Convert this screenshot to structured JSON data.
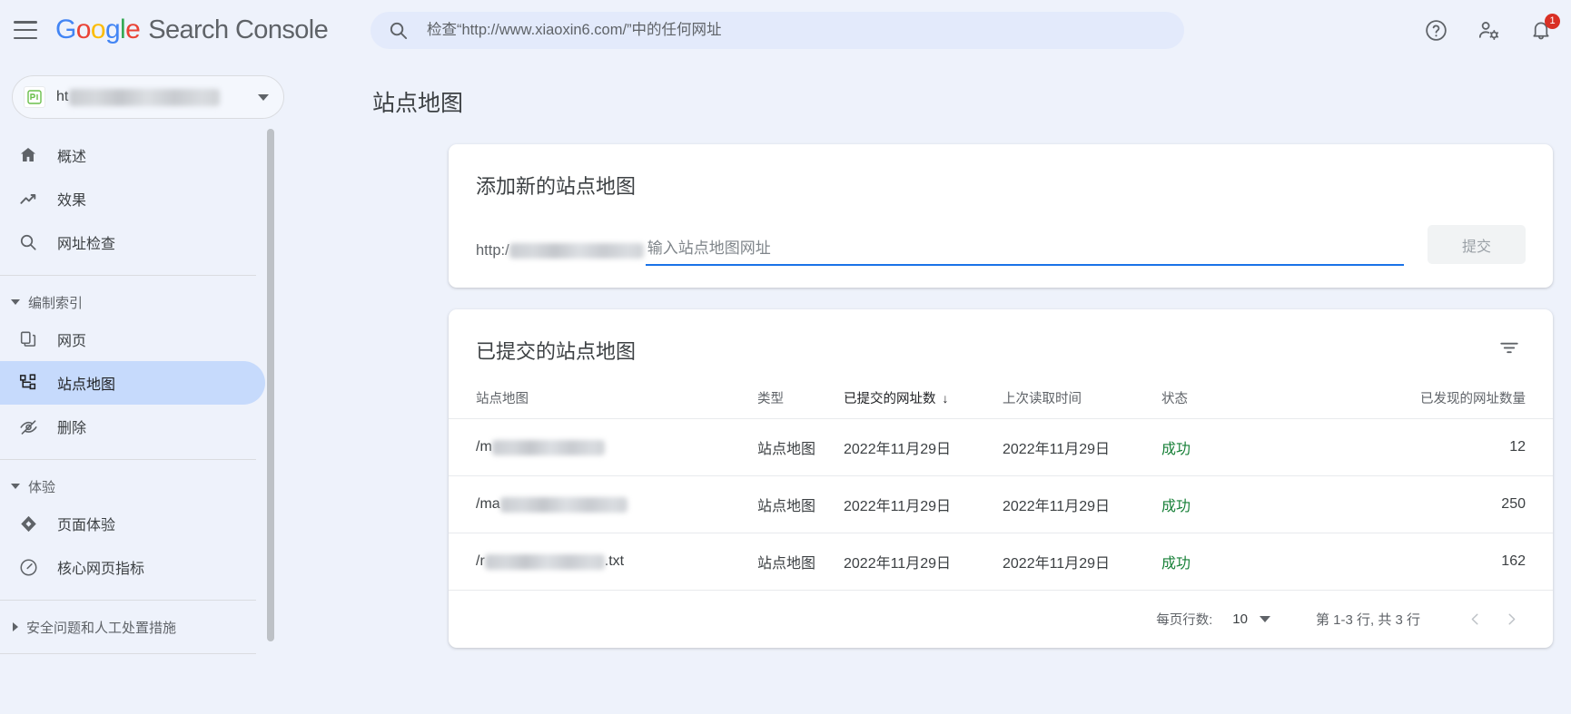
{
  "header": {
    "menu_icon": "hamburger-icon",
    "brand_google": [
      "G",
      "o",
      "o",
      "g",
      "l",
      "e"
    ],
    "brand_product": "Search Console",
    "search": {
      "icon": "search-icon",
      "value": "",
      "placeholder": "检查“http://www.xiaoxin6.com/”中的任何网址"
    },
    "icons": {
      "help": "help-icon",
      "account_settings": "account-settings-icon",
      "notifications": "bell-icon",
      "notification_count": "1"
    }
  },
  "sidebar": {
    "property": {
      "favicon": "site-favicon",
      "prefix": "ht",
      "redacted": true
    },
    "items": [
      {
        "label": "概述",
        "icon": "home-icon",
        "active": false
      },
      {
        "label": "效果",
        "icon": "trending-up-icon",
        "active": false
      },
      {
        "label": "网址检查",
        "icon": "search-icon",
        "active": false
      }
    ],
    "groups": [
      {
        "label": "编制索引",
        "expanded": true,
        "items": [
          {
            "label": "网页",
            "icon": "pages-icon",
            "active": false
          },
          {
            "label": "站点地图",
            "icon": "sitemap-icon",
            "active": true
          },
          {
            "label": "删除",
            "icon": "eye-off-icon",
            "active": false
          }
        ]
      },
      {
        "label": "体验",
        "expanded": true,
        "items": [
          {
            "label": "页面体验",
            "icon": "page-experience-icon",
            "active": false
          },
          {
            "label": "核心网页指标",
            "icon": "speedometer-icon",
            "active": false
          }
        ]
      },
      {
        "label": "安全问题和人工处置措施",
        "expanded": false,
        "items": []
      }
    ]
  },
  "main": {
    "page_title": "站点地图",
    "add_card": {
      "title": "添加新的站点地图",
      "url_prefix": "http:/",
      "input_value": "",
      "input_placeholder": "输入站点地图网址",
      "submit_label": "提交",
      "submit_disabled": true
    },
    "table_card": {
      "title": "已提交的站点地图",
      "filter_icon": "filter-icon",
      "columns": [
        {
          "label": "站点地图",
          "sorted": false,
          "align": "left"
        },
        {
          "label": "类型",
          "sorted": false,
          "align": "left"
        },
        {
          "label": "已提交的网址数",
          "sorted": true,
          "sort_dir": "↓",
          "align": "left"
        },
        {
          "label": "上次读取时间",
          "sorted": false,
          "align": "left"
        },
        {
          "label": "状态",
          "sorted": false,
          "align": "left"
        },
        {
          "label": "已发现的网址数量",
          "sorted": false,
          "align": "right"
        }
      ],
      "rows": [
        {
          "sitemap_prefix": "/m",
          "sitemap_suffix": "",
          "redacted_width": 124,
          "type": "站点地图",
          "submitted": "2022年11月29日",
          "last_read": "2022年11月29日",
          "status": "成功",
          "discovered": "12"
        },
        {
          "sitemap_prefix": "/ma",
          "sitemap_suffix": "",
          "redacted_width": 140,
          "type": "站点地图",
          "submitted": "2022年11月29日",
          "last_read": "2022年11月29日",
          "status": "成功",
          "discovered": "250"
        },
        {
          "sitemap_prefix": "/r",
          "sitemap_suffix": ".txt",
          "redacted_width": 132,
          "type": "站点地图",
          "submitted": "2022年11月29日",
          "last_read": "2022年11月29日",
          "status": "成功",
          "discovered": "162"
        }
      ],
      "pagination": {
        "rows_label": "每页行数:",
        "rows_value": "10",
        "range_label": "第 1-3 行, 共 3 行",
        "prev_icon": "chevron-left-icon",
        "next_icon": "chevron-right-icon"
      }
    }
  },
  "colors": {
    "accent": "#1a73e8",
    "active_nav": "#c6dafc",
    "success": "#188038",
    "badge": "#d93025",
    "page_bg": "#eef2fb"
  }
}
